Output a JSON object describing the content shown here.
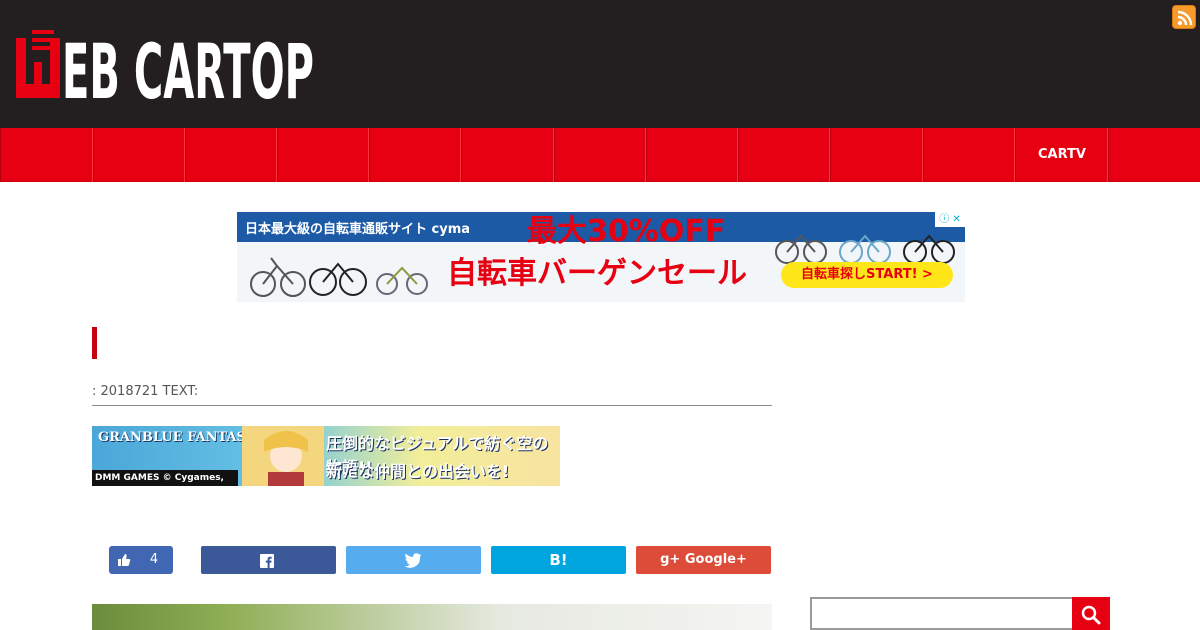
{
  "site": {
    "logo_text": "WEB CARTOP"
  },
  "header": {
    "rss_icon": "rss-icon"
  },
  "nav": {
    "items": [
      "",
      "",
      "",
      "",
      "",
      "",
      "",
      "",
      "",
      "",
      "",
      "CARTV",
      ""
    ]
  },
  "ads": {
    "top": {
      "headline": "日本最大級の自転車通販サイト cyma",
      "discount": "最大30%OFF",
      "sale": "自転車バーゲンセール",
      "cta": "自転車探しSTART! >",
      "info": "ⓘ ✕"
    },
    "gbf": {
      "logo": "GRANBLUE FANTASY",
      "line1": "圧倒的なビジュアルで紡ぐ空の物語!!",
      "line2": "新たな仲間との出会いを!",
      "credit": "DMM GAMES © Cygames, Inc."
    }
  },
  "article": {
    "meta": ": 2018721  TEXT:"
  },
  "share": {
    "like_count": "4",
    "google_label": "Google+",
    "hatena_label": "B!"
  },
  "colors": {
    "brand_red": "#e60012",
    "header_bg": "#231f20"
  }
}
